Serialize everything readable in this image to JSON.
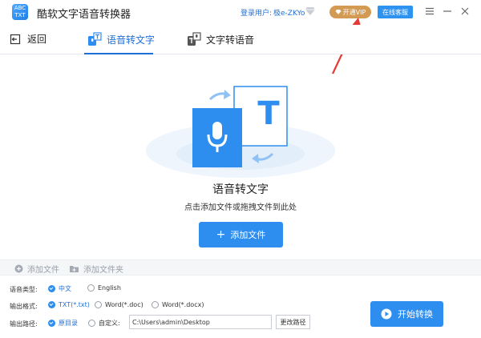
{
  "app": {
    "title": "酷软文字语音转换器",
    "logo_text": "ABC TXT"
  },
  "header": {
    "login_label": "登录用户:",
    "username": "极e-ZKYo",
    "vip_label": "开通VIP",
    "service_label": "在线客服"
  },
  "tabs": {
    "back_label": "返回",
    "items": [
      {
        "label": "语音转文字",
        "active": true
      },
      {
        "label": "文字转语音",
        "active": false
      }
    ]
  },
  "hero": {
    "title": "语音转文字",
    "subtitle": "点击添加文件或拖拽文件到此处",
    "add_button": "添加文件",
    "illustration_letter": "T"
  },
  "filebar": {
    "add_file": "添加文件",
    "add_folder": "添加文件夹"
  },
  "options": {
    "language": {
      "label": "语音类型:",
      "choices": [
        {
          "label": "中文",
          "selected": true
        },
        {
          "label": "English",
          "selected": false
        }
      ]
    },
    "format": {
      "label": "输出格式:",
      "choices": [
        {
          "label": "TXT(*.txt)",
          "selected": true
        },
        {
          "label": "Word(*.doc)",
          "selected": false
        },
        {
          "label": "Word(*.docx)",
          "selected": false
        }
      ]
    },
    "path": {
      "label": "输出路径:",
      "choices": [
        {
          "label": "原目录",
          "selected": true
        },
        {
          "label": "自定义:",
          "selected": false
        }
      ],
      "value": "C:\\Users\\admin\\Desktop",
      "change_button": "更改路径"
    },
    "start_button": "开始转换"
  },
  "colors": {
    "accent": "#2e8ef0",
    "accent_text": "#1f6fd8",
    "vip": "#d39a53",
    "annotation_arrow": "#e53935"
  }
}
